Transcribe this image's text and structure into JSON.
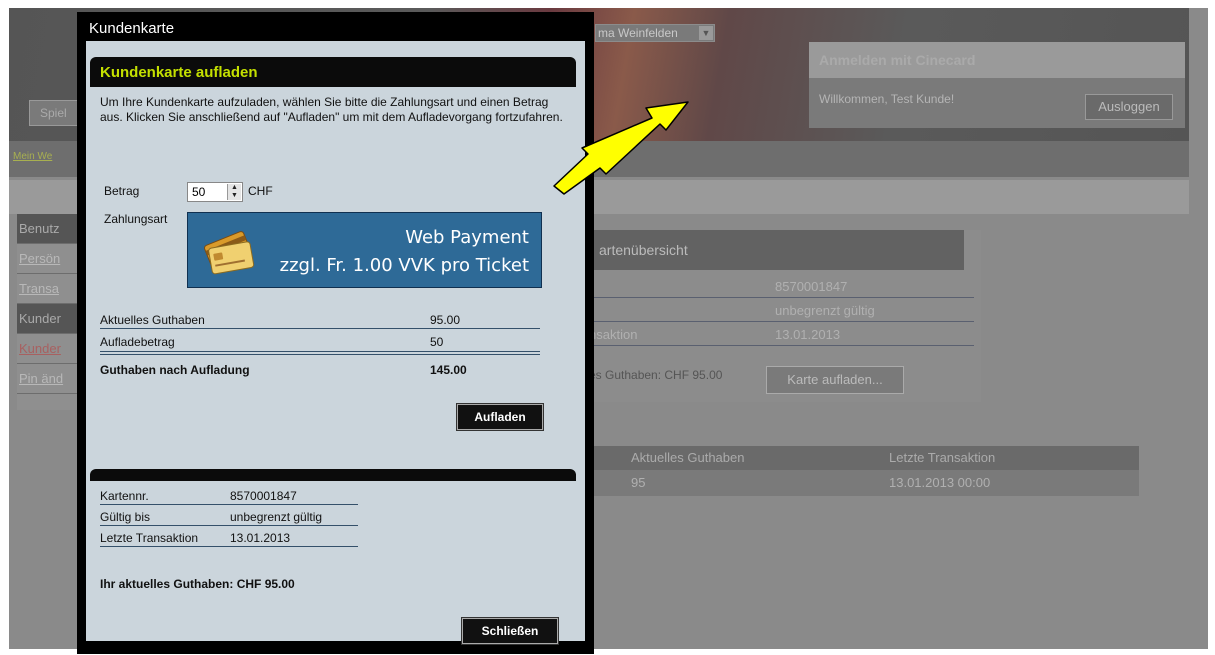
{
  "background": {
    "location_dropdown": "ma Weinfelden",
    "login_box": {
      "title": "Anmelden mit Cinecard",
      "welcome": "Willkommen, Test Kunde!",
      "logout_button": "Ausloggen"
    },
    "spielplan_button": "Spiel",
    "mein_web_link": "Mein We",
    "sidebar": [
      {
        "label": "Benutz",
        "style": "header"
      },
      {
        "label": "Persön",
        "style": "link"
      },
      {
        "label": "Transa",
        "style": "link"
      },
      {
        "label": "Kunder",
        "style": "header"
      },
      {
        "label": "Kunder",
        "style": "active"
      },
      {
        "label": "Pin änd",
        "style": "link"
      }
    ],
    "card_overview": {
      "title": "artenübersicht",
      "rows": [
        {
          "label": "",
          "value": "8570001847"
        },
        {
          "label": "",
          "value": "unbegrenzt gültig"
        },
        {
          "label": "nsaktion",
          "value": "13.01.2013"
        }
      ],
      "balance_text": "es Guthaben: CHF 95.00",
      "recharge_button": "Karte aufladen..."
    },
    "table": {
      "headers": [
        "",
        "Aktuelles Guthaben",
        "Letzte Transaktion"
      ],
      "rows": [
        [
          "",
          "95",
          "13.01.2013 00:00"
        ]
      ]
    }
  },
  "modal": {
    "title": "Kundenkarte",
    "recharge_panel": {
      "heading": "Kundenkarte aufladen",
      "intro": "Um Ihre Kundenkarte aufzuladen, wählen Sie bitte die Zahlungsart und einen Betrag aus. Klicken Sie anschließend auf \"Aufladen\" um mit dem Aufladevorgang fortzufahren.",
      "amount_label": "Betrag",
      "amount_value": "50",
      "currency": "CHF",
      "payment_label": "Zahlungsart",
      "payment_option_line1": "Web Payment",
      "payment_option_line2": "zzgl. Fr. 1.00 VVK pro Ticket",
      "summary": [
        {
          "label": "Aktuelles Guthaben",
          "value": "95.00"
        },
        {
          "label": "Aufladebetrag",
          "value": "50"
        }
      ],
      "total": {
        "label": "Guthaben nach Aufladung",
        "value": "145.00"
      },
      "recharge_button": "Aufladen"
    },
    "card_info": {
      "rows": [
        {
          "label": "Kartennr.",
          "value": "8570001847"
        },
        {
          "label": "Gültig bis",
          "value": "unbegrenzt gültig"
        },
        {
          "label": "Letzte Transaktion",
          "value": "13.01.2013"
        }
      ],
      "balance": "Ihr aktuelles Guthaben: CHF 95.00"
    },
    "close_button": "Schließen"
  },
  "colors": {
    "heading_accent": "#c4e000",
    "panel_bg": "#cbd5dc",
    "payment_bg": "#2e6a97",
    "arrow": "#ffff00"
  }
}
